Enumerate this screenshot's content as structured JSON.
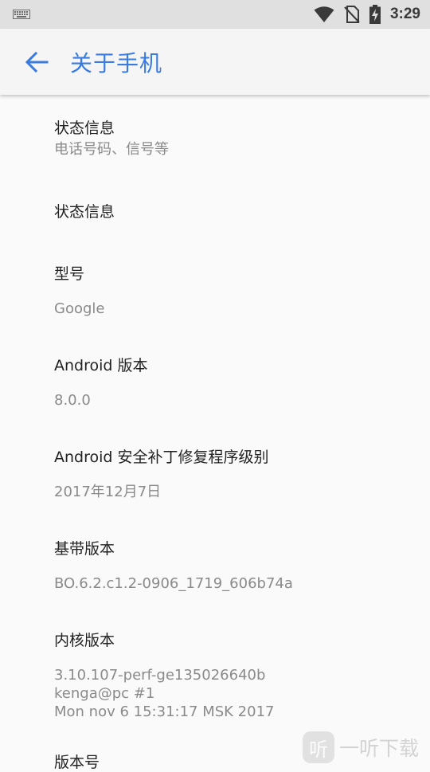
{
  "status_bar": {
    "time": "3:29"
  },
  "app_bar": {
    "title": "关于手机"
  },
  "items": [
    {
      "title": "状态信息",
      "summary": "电话号码、信号等"
    },
    {
      "title": "状态信息",
      "summary": ""
    },
    {
      "title": "型号",
      "summary": "Google"
    },
    {
      "title": "Android 版本",
      "summary": "8.0.0"
    },
    {
      "title": "Android 安全补丁修复程序级别",
      "summary": "2017年12月7日"
    },
    {
      "title": "基带版本",
      "summary": "BO.6.2.c1.2-0906_1719_606b74a"
    },
    {
      "title": "内核版本",
      "summary_lines": [
        "3.10.107-perf-ge135026640b",
        "kenga@pc #1",
        "Mon nov 6 15:31:17 MSK 2017"
      ]
    },
    {
      "title": "版本号"
    }
  ],
  "watermark": {
    "logo": "听",
    "text": "一听下载"
  },
  "colors": {
    "accent": "#3a7be0",
    "status_bar": "#e0e0e0",
    "background": "#fafafa"
  },
  "icons": [
    "keyboard-icon",
    "wifi-icon",
    "no-sim-icon",
    "battery-charging-icon",
    "back-arrow-icon"
  ]
}
